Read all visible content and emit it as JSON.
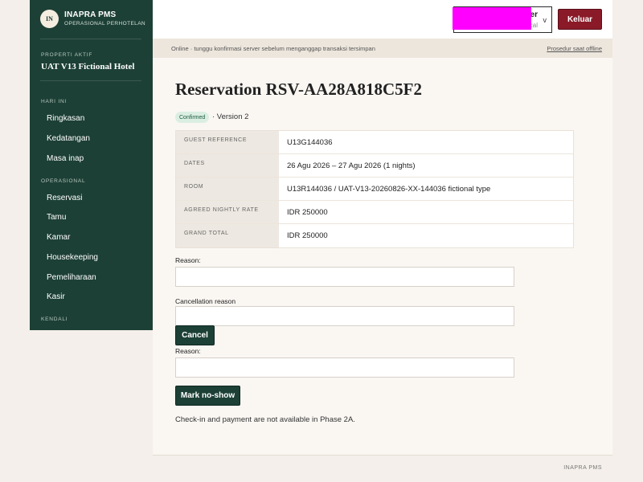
{
  "sidebar": {
    "logo": "IN",
    "brand": "INAPRA PMS",
    "brand_sub": "OPERASIONAL PERHOTELAN",
    "property_label": "PROPERTI AKTIF",
    "property_name": "UAT V13 Fictional Hotel",
    "sections": [
      {
        "title": "HARI INI",
        "items": [
          "Ringkasan",
          "Kedatangan",
          "Masa inap"
        ]
      },
      {
        "title": "OPERASIONAL",
        "items": [
          "Reservasi",
          "Tamu",
          "Kamar",
          "Housekeeping",
          "Pemeliharaan",
          "Kasir"
        ]
      },
      {
        "title": "KENDALI",
        "items": []
      }
    ]
  },
  "header": {
    "user_name": "er",
    "user_role": "cal",
    "user_caret": "v",
    "logout_label": "Keluar",
    "mask_color": "#ff00ff"
  },
  "status": {
    "text": "Online · tunggu konfirmasi server sebelum menganggap transaksi tersimpan",
    "link": "Prosedur saat offline"
  },
  "main": {
    "title": "Reservation RSV-AA28A818C5F2",
    "status_badge": "Confirmed",
    "version": "· Version 2",
    "details": [
      {
        "label": "GUEST REFERENCE",
        "value": "U13G144036"
      },
      {
        "label": "DATES",
        "value": "26 Agu 2026 – 27 Agu 2026 (1 nights)"
      },
      {
        "label": "ROOM",
        "value": "U13R144036 / UAT-V13-20260826-XX-144036 fictional type"
      },
      {
        "label": "AGREED NIGHTLY RATE",
        "value": "IDR 250000"
      },
      {
        "label": "GRAND TOTAL",
        "value": "IDR 250000"
      }
    ],
    "reason_label_1": "Reason:",
    "reason_value_1": "",
    "cancellation_label": "Cancellation reason",
    "cancellation_value": "",
    "cancel_button": "Cancel",
    "reason_label_2": "Reason:",
    "reason_value_2": "",
    "noshow_button": "Mark no-show",
    "note": "Check-in and payment are not available in Phase 2A."
  },
  "footer": {
    "text": "INAPRA PMS"
  },
  "colors": {
    "sidebar": "#1d4036",
    "primary_button": "#1d4036",
    "logout_button": "#8a1a28",
    "badge_bg": "#dbeee2"
  }
}
